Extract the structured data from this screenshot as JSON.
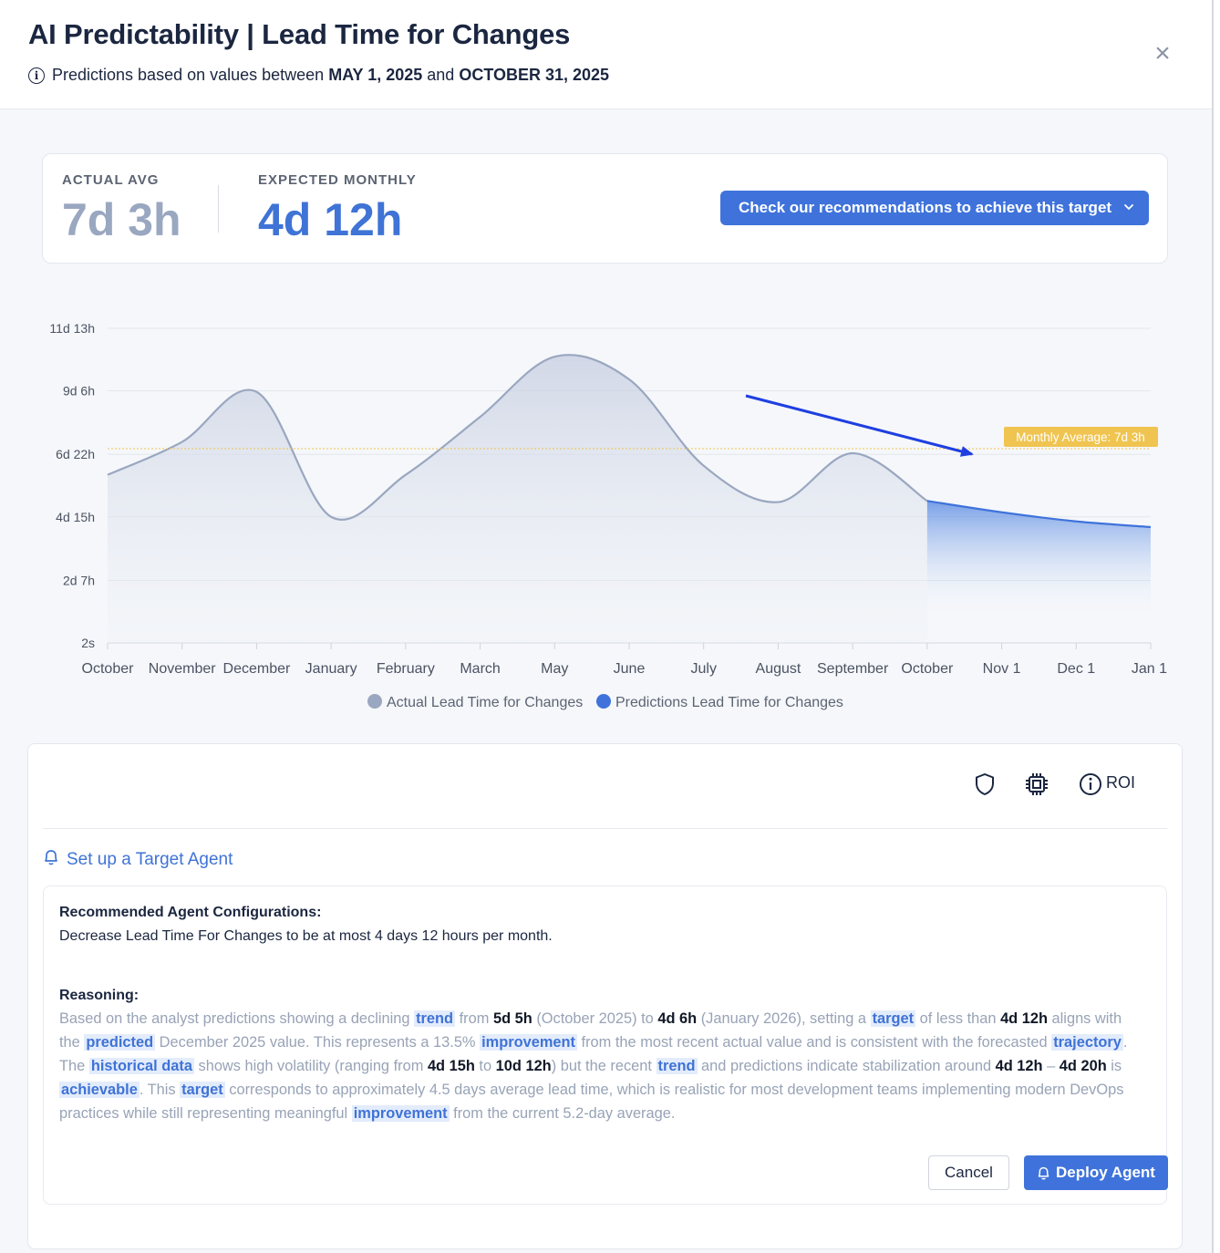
{
  "header": {
    "title": "AI Predictability | Lead Time for Changes",
    "subtitle_prefix": "Predictions based on values between",
    "date_start": "MAY 1, 2025",
    "subtitle_and": "and",
    "date_end": "OCTOBER 31, 2025",
    "close_glyph": "×"
  },
  "kpis": {
    "actual_label": "ACTUAL AVG",
    "actual_value": "7d 3h",
    "expected_label": "EXPECTED MONTHLY",
    "expected_value": "4d 12h",
    "recommend_button": "Check our recommendations to achieve this target"
  },
  "chart_data": {
    "type": "area",
    "y_tick_labels": [
      "11d 13h",
      "9d 6h",
      "6d 22h",
      "4d 15h",
      "2d 7h",
      "2s"
    ],
    "y_ticks_hours": [
      277,
      222,
      166,
      111,
      55,
      0
    ],
    "ylim_hours": [
      0,
      277
    ],
    "x_labels": [
      "October",
      "November",
      "December",
      "January",
      "February",
      "March",
      "May",
      "June",
      "July",
      "August",
      "September",
      "October",
      "Nov 1",
      "Dec 1",
      "Jan 1"
    ],
    "series": [
      {
        "name": "Actual Lead Time for Changes",
        "color": "#9aa7c0",
        "values_hours": [
          148,
          177,
          221,
          111,
          148,
          199,
          252,
          232,
          156,
          124,
          167,
          125
        ]
      },
      {
        "name": "Predictions Lead Time for Changes",
        "color": "#3f73db",
        "start_index": 11,
        "values_hours": [
          125,
          115,
          107,
          102
        ]
      }
    ],
    "reference_line": {
      "label": "Monthly Average: 7d 3h",
      "value_hours": 171,
      "color": "#f0c450"
    },
    "grid": true,
    "legend": "bottom"
  },
  "toolbar": {
    "roi_label": "ROI"
  },
  "agent": {
    "setup_link": "Set up a Target Agent",
    "config_heading": "Recommended Agent Configurations:",
    "config_text": "Decrease Lead Time For Changes to be at most 4 days 12 hours per month.",
    "reasoning_heading": "Reasoning:",
    "cancel_label": "Cancel",
    "deploy_label": "Deploy Agent"
  },
  "reasoning": {
    "t1": "Based on the analyst predictions showing a declining ",
    "h1": "trend",
    "t2": " from ",
    "n1": "5d 5h",
    "t3": " (October 2025) to ",
    "n2": "4d 6h",
    "t4": " (January 2026), setting a ",
    "h2": "target",
    "t5": " of less than ",
    "n3": "4d 12h",
    "t6": " aligns with the ",
    "h3": "predicted",
    "t7": " December 2025 value. This represents a 13.5% ",
    "h4": "improvement",
    "t8": " from the most recent actual value and is consistent with the forecasted ",
    "h5": "trajectory",
    "t9": ". The ",
    "h6": "historical data",
    "t10": " shows high volatility (ranging from ",
    "n4": "4d 15h",
    "t11": " to ",
    "n5": "10d 12h",
    "t12": ") but the recent ",
    "h7": "trend",
    "t13": " and predictions indicate stabilization around ",
    "n6": "4d 12h",
    "t14": " – ",
    "n7": "4d 20h",
    "t15": " is ",
    "h8": "achievable",
    "t16": ". This ",
    "h9": "target",
    "t17": " corresponds to approximately 4.5 days average lead time, which is realistic for most development teams implementing modern DevOps practices while still representing meaningful ",
    "h10": "improvement",
    "t18": " from the current 5.2-day average."
  }
}
